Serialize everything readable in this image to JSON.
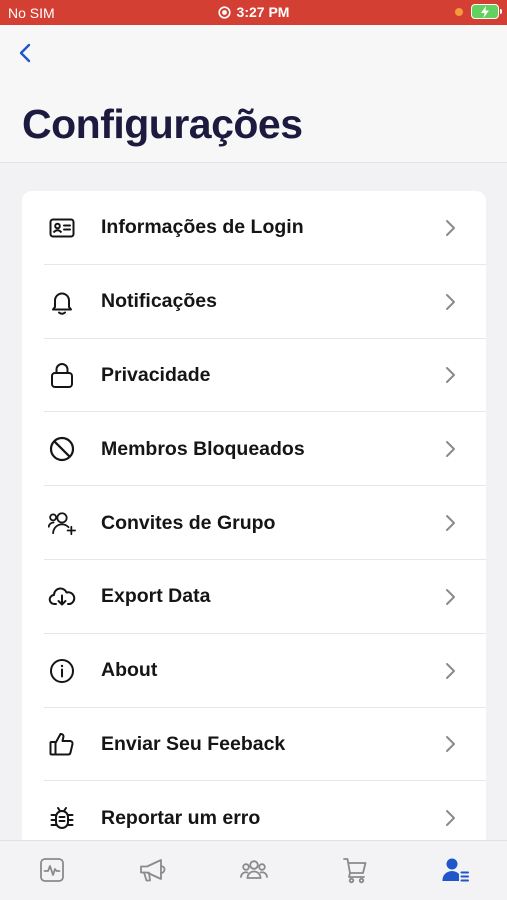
{
  "status_bar": {
    "carrier": "No SIM",
    "time": "3:27 PM"
  },
  "header": {
    "title": "Configurações"
  },
  "settings": {
    "items": [
      {
        "label": "Informações de Login",
        "icon": "id-card-icon"
      },
      {
        "label": "Notificações",
        "icon": "bell-icon"
      },
      {
        "label": "Privacidade",
        "icon": "lock-icon"
      },
      {
        "label": "Membros Bloqueados",
        "icon": "block-icon"
      },
      {
        "label": "Convites de Grupo",
        "icon": "group-add-icon"
      },
      {
        "label": "Export Data",
        "icon": "cloud-download-icon"
      },
      {
        "label": "About",
        "icon": "info-icon"
      },
      {
        "label": "Enviar Seu Feeback",
        "icon": "thumbs-up-icon"
      },
      {
        "label": "Reportar um erro",
        "icon": "bug-icon"
      }
    ]
  },
  "tabbar": {
    "tabs": [
      {
        "icon": "activity-icon",
        "active": false
      },
      {
        "icon": "megaphone-icon",
        "active": false
      },
      {
        "icon": "people-icon",
        "active": false
      },
      {
        "icon": "cart-icon",
        "active": false
      },
      {
        "icon": "profile-settings-icon",
        "active": true
      }
    ]
  },
  "colors": {
    "status_bar": "#d33f33",
    "title": "#1c1b3f",
    "accent": "#1f56c9",
    "tab_inactive": "#8a8a8e"
  }
}
